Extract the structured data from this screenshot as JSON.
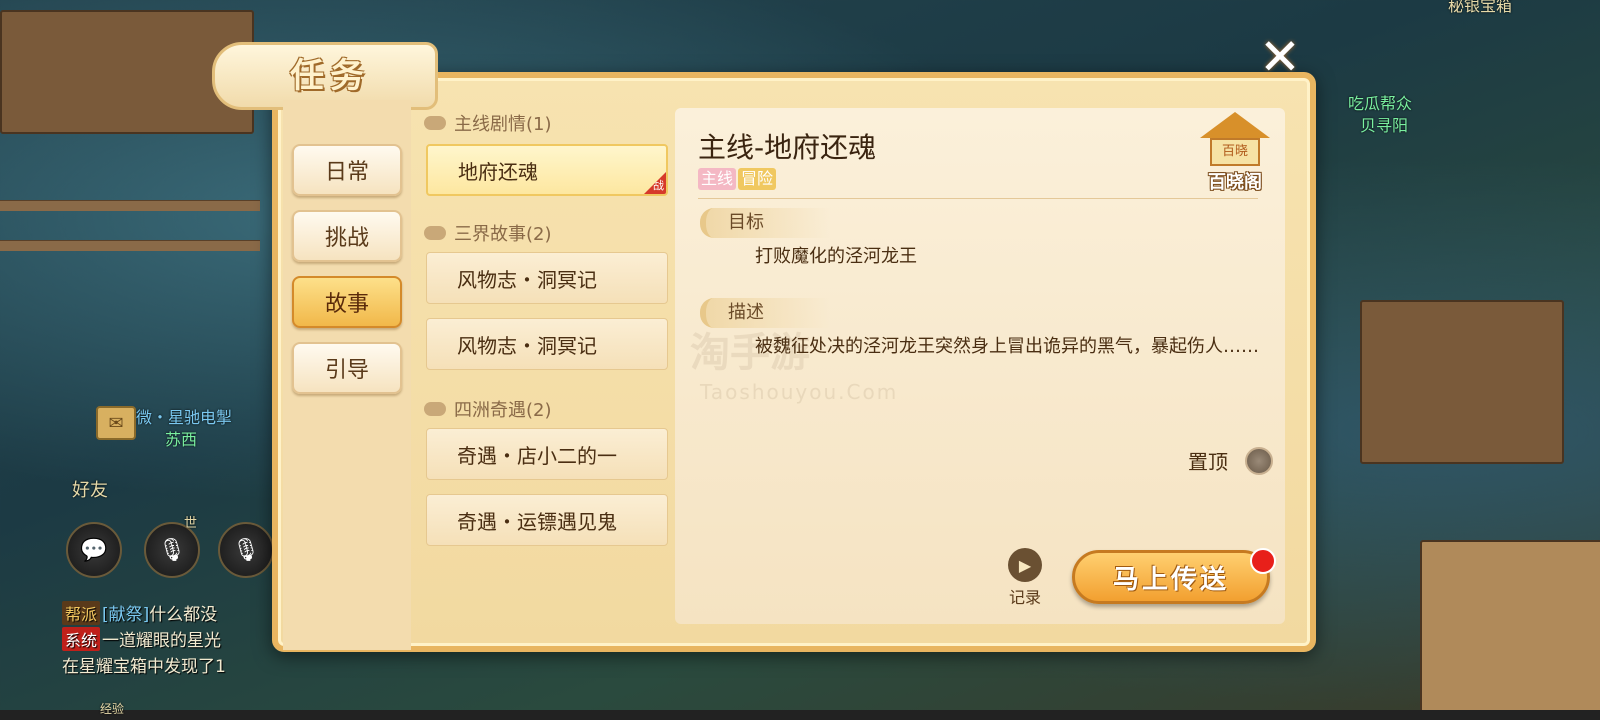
{
  "window": {
    "title": "任务",
    "close_icon": "✕"
  },
  "categories": [
    {
      "label": "日常",
      "active": false
    },
    {
      "label": "挑战",
      "active": false
    },
    {
      "label": "故事",
      "active": true
    },
    {
      "label": "引导",
      "active": false
    }
  ],
  "task_groups": [
    {
      "heading": "主线剧情(1)",
      "items": [
        {
          "label": "地府还魂",
          "badge": "战",
          "active": true
        }
      ]
    },
    {
      "heading": "三界故事(2)",
      "items": [
        {
          "label": "风物志・洞冥记"
        },
        {
          "label": "风物志・洞冥记"
        }
      ]
    },
    {
      "heading": "四洲奇遇(2)",
      "items": [
        {
          "label": "奇遇・店小二的一"
        },
        {
          "label": "奇遇・运镖遇见鬼"
        }
      ]
    }
  ],
  "detail": {
    "title": "主线-地府还魂",
    "tags": [
      "主线",
      "冒险"
    ],
    "goal_label": "目标",
    "goal_text": "打败魔化的泾河龙王",
    "desc_label": "描述",
    "desc_text": "被魏征处决的泾河龙王突然身上冒出诡异的黑气，暴起伤人……",
    "pin_label": "置顶",
    "record_label": "记录",
    "teleport_label": "马上传送",
    "pavilion_label": "百晓阁",
    "pavilion_sign": "百晓"
  },
  "hud": {
    "friend_label": "好友",
    "channel_world": "世",
    "mail_icon": "mail-icon",
    "chat_icon": "speech-bubble-icon",
    "mic_icon": "microphone-icon"
  },
  "scene": {
    "npc_name_top": "秘银宝箱",
    "npc_guild": "吃瓜帮众",
    "npc_name": "贝寻阳",
    "player_title": "紫微・星驰电掣",
    "player_name": "苏西",
    "exp_label": "经验"
  },
  "chat": [
    {
      "tag": "帮派",
      "tag_color": "#5a3a1a",
      "prefix": "[献祭]",
      "text": "什么都没"
    },
    {
      "tag": "系统",
      "tag_color": "#c0201a",
      "prefix": "",
      "text": "一道耀眼的星光"
    },
    {
      "tag": "",
      "tag_color": "",
      "prefix": "",
      "text": "在星耀宝箱中发现了1"
    }
  ],
  "watermark": {
    "main": "淘手游",
    "sub": "Taoshouyou.Com"
  },
  "colors": {
    "accent": "#f2a030",
    "frame": "#e8b560",
    "notify": "#e8201a"
  }
}
